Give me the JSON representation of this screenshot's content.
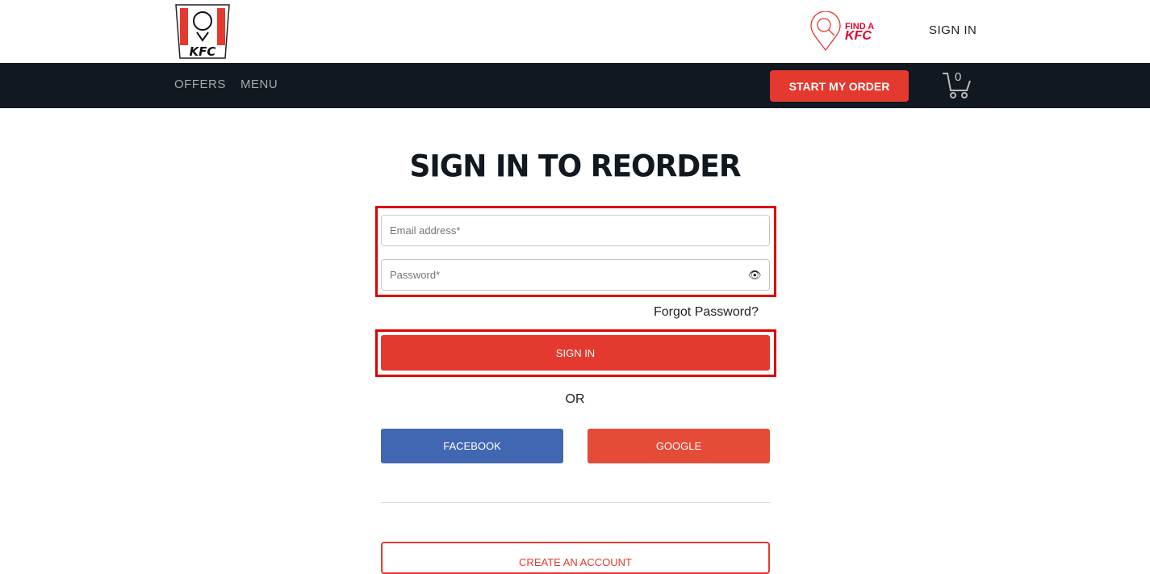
{
  "header": {
    "logo_text": "KFC",
    "find_a": "FIND A",
    "find_kfc": "KFC",
    "sign_in": "SIGN IN"
  },
  "nav": {
    "offers": "OFFERS",
    "menu": "MENU",
    "start_order": "START MY ORDER",
    "cart_count": "0"
  },
  "main": {
    "title": "SIGN IN TO REORDER",
    "email_placeholder": "Email address*",
    "password_placeholder": "Password*",
    "forgot": "Forgot Password?",
    "sign_in": "SIGN IN",
    "or": "OR",
    "facebook": "FACEBOOK",
    "google": "GOOGLE",
    "create_account": "CREATE AN ACCOUNT"
  },
  "colors": {
    "brand_red": "#e4392f",
    "facebook": "#4267b2",
    "nav_bg": "#111820"
  }
}
